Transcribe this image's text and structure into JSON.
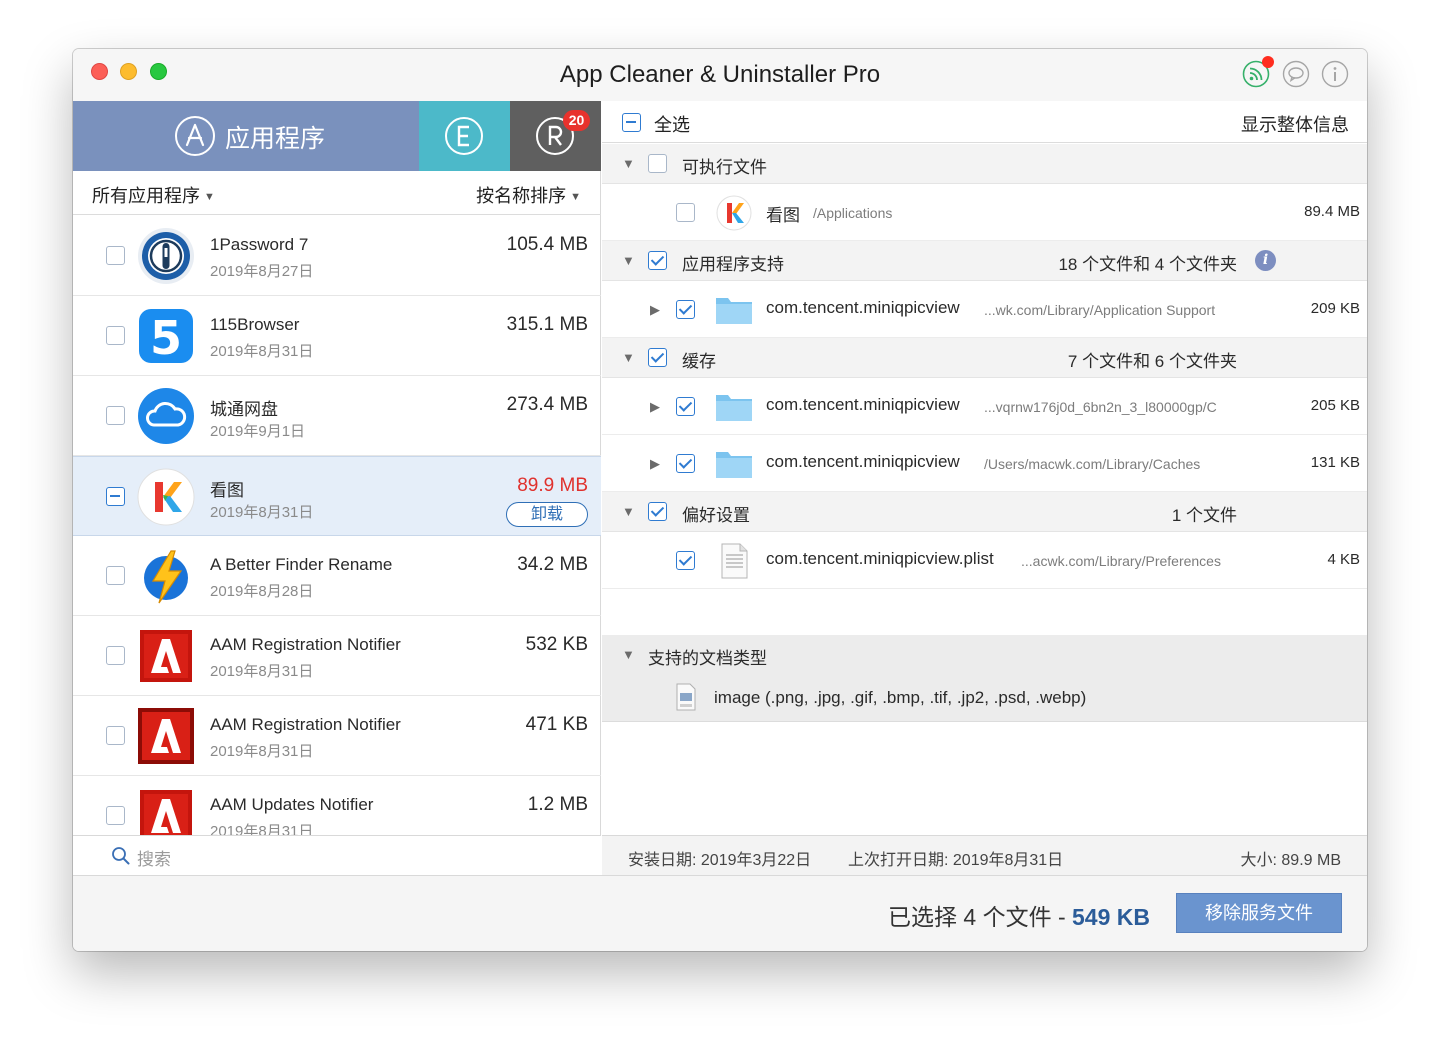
{
  "window": {
    "title": "App Cleaner & Uninstaller Pro"
  },
  "tabs": {
    "apps_label": "应用程序",
    "remains_badge": "20"
  },
  "filter": {
    "all_apps": "所有应用程序",
    "sort": "按名称排序"
  },
  "apps": [
    {
      "name": "1Password 7",
      "date": "2019年8月27日",
      "size": "105.4 MB",
      "icon": "1password-icon"
    },
    {
      "name": "115Browser",
      "date": "2019年8月31日",
      "size": "315.1 MB",
      "icon": "115browser-icon"
    },
    {
      "name": "城通网盘",
      "date": "2019年9月1日",
      "size": "273.4 MB",
      "icon": "cloud-icon"
    },
    {
      "name": "看图",
      "date": "2019年8月31日",
      "size": "89.9 MB",
      "icon": "kantu-icon",
      "action": "卸载"
    },
    {
      "name": "A Better Finder Rename",
      "date": "2019年8月28日",
      "size": "34.2 MB",
      "icon": "lightning-icon"
    },
    {
      "name": "AAM Registration Notifier",
      "date": "2019年8月31日",
      "size": "532 KB",
      "icon": "adobe-icon"
    },
    {
      "name": "AAM Registration Notifier",
      "date": "2019年8月31日",
      "size": "471 KB",
      "icon": "adobe-icon"
    },
    {
      "name": "AAM Updates Notifier",
      "date": "2019年8月31日",
      "size": "1.2 MB",
      "icon": "adobe-icon"
    }
  ],
  "search": {
    "placeholder": "搜索"
  },
  "details": {
    "select_all": "全选",
    "show_info": "显示整体信息",
    "executables": {
      "label": "可执行文件",
      "item": {
        "name": "看图",
        "path": "/Applications",
        "size": "89.4 MB"
      }
    },
    "app_support": {
      "label": "应用程序支持",
      "count": "18 个文件和 4 个文件夹",
      "item": {
        "name": "com.tencent.miniqpicview",
        "path": "...wk.com/Library/Application Support",
        "size": "209 KB"
      }
    },
    "caches": {
      "label": "缓存",
      "count": "7 个文件和 6 个文件夹",
      "items": [
        {
          "name": "com.tencent.miniqpicview",
          "path": "...vqrnw176j0d_6bn2n_3_l80000gp/C",
          "size": "205 KB"
        },
        {
          "name": "com.tencent.miniqpicview",
          "path": "/Users/macwk.com/Library/Caches",
          "size": "131 KB"
        }
      ]
    },
    "preferences": {
      "label": "偏好设置",
      "count": "1 个文件",
      "item": {
        "name": "com.tencent.miniqpicview.plist",
        "path": "...acwk.com/Library/Preferences",
        "size": "4 KB"
      }
    },
    "doc_types": {
      "label": "支持的文档类型",
      "text": "image (.png, .jpg, .gif, .bmp, .tif, .jp2, .psd, .webp)"
    }
  },
  "status": {
    "install_date": "安装日期: 2019年3月22日",
    "last_opened": "上次打开日期: 2019年8月31日",
    "size": "大小: 89.9 MB"
  },
  "bottom": {
    "selected_prefix": "已选择 4 个文件 - ",
    "selected_size": "549 KB",
    "remove_button": "移除服务文件"
  },
  "colors": {
    "apps_tab": "#7a91bd",
    "extensions_tab": "#4cb9c9",
    "remains_tab": "#5f5f5f",
    "selected_size": "#e0312d",
    "accent": "#2f6fb6",
    "remove_button": "#6a94cf"
  }
}
